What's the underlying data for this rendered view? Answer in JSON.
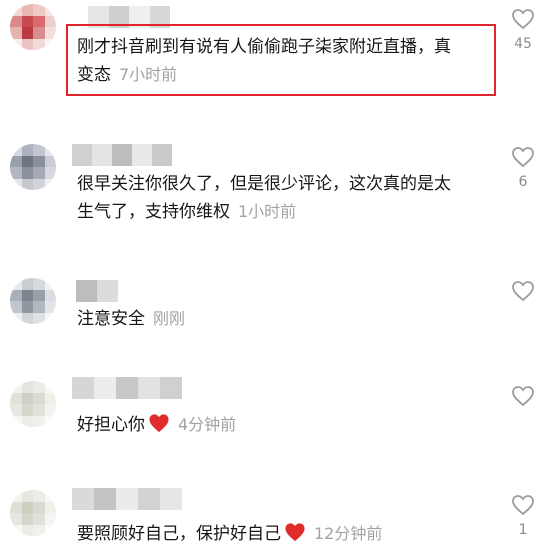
{
  "comments": [
    {
      "line1": "刚才抖音刷到有说有人偷偷跑子柒家附近直播，真",
      "line2": "变态",
      "time": "7小时前",
      "likes": "45",
      "highlighted": true
    },
    {
      "line1": "很早关注你很久了，但是很少评论，这次真的是太",
      "line2": "生气了，支持你维权",
      "time": "1小时前",
      "likes": "6"
    },
    {
      "line1": "注意安全",
      "time": "刚刚",
      "likes": ""
    },
    {
      "line1": "好担心你",
      "emoji": "heart-emoji",
      "time": "4分钟前",
      "likes": ""
    },
    {
      "line1": "要照顾好自己，保护好自己",
      "emoji": "heart-emoji",
      "time": "12分钟前",
      "likes": "1"
    }
  ],
  "colors": {
    "highlight_border": "#e0262c",
    "heart_emoji": "#e02b2b",
    "timestamp": "#a3a3a3"
  }
}
